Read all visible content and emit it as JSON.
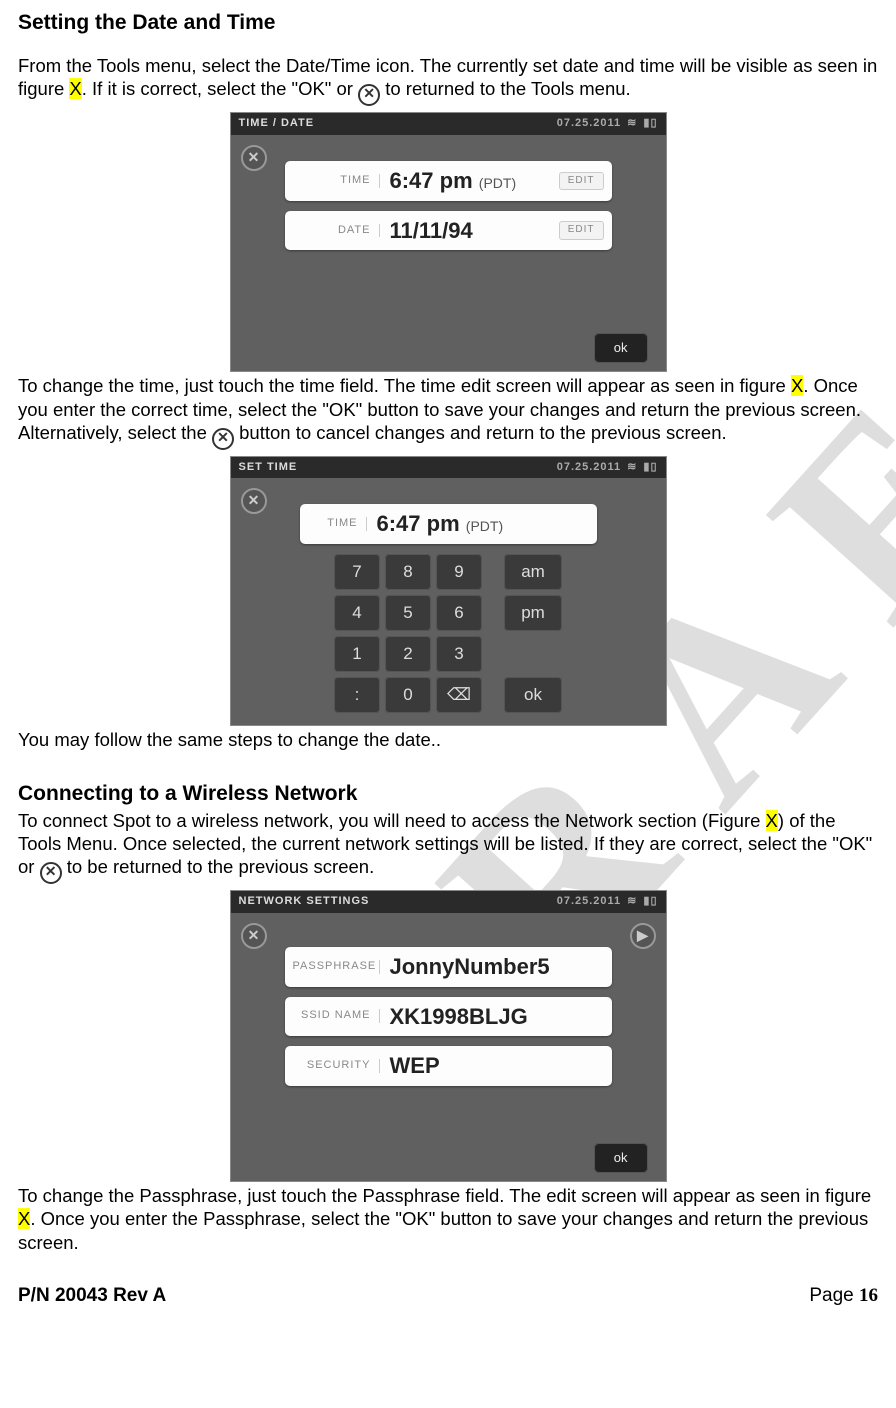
{
  "watermark": "DRAFT",
  "heading1": "Setting the Date and Time",
  "para1a": "From the Tools menu, select the Date/Time icon.  The currently set date and time will be visible as seen in figure ",
  "fig1": "X",
  "para1b": ".  If it is correct, select the \"OK\" or ",
  "para1c": " to returned to the Tools menu.",
  "screen1": {
    "title": "TIME / DATE",
    "date_status": "07.25.2011",
    "time_label": "TIME",
    "time_value": "6:47 pm",
    "tz": "(PDT)",
    "edit": "EDIT",
    "date_label": "DATE",
    "date_value": "11/11/94",
    "ok": "ok"
  },
  "para2a": "To change the time, just touch the time field.  The time edit screen will appear as seen in figure ",
  "fig2": "X",
  "para2b": ". Once you enter the correct time, select the \"OK\" button to save your changes and return the previous screen.  Alternatively, select the ",
  "para2c": " button to cancel changes and return to the previous screen.",
  "screen2": {
    "title": "SET  TIME",
    "date_status": "07.25.2011",
    "time_label": "TIME",
    "time_value": "6:47 pm",
    "tz": "(PDT)",
    "keys": [
      "7",
      "8",
      "9",
      "4",
      "5",
      "6",
      "1",
      "2",
      "3",
      ":",
      "0",
      "⌫"
    ],
    "ampm": [
      "am",
      "pm"
    ],
    "ok": "ok"
  },
  "para3": "You may follow the same steps to change the date..",
  "heading2": "Connecting to a Wireless Network",
  "para4a": "To connect Spot to a wireless network, you will need to access the Network section (Figure ",
  "fig3": "X",
  "para4b": ") of the Tools Menu.  Once selected, the current network settings will be listed.  If they are correct, select the \"OK\" or ",
  "para4c": " to be returned to the previous screen.",
  "screen3": {
    "title": "NETWORK  SETTINGS",
    "date_status": "07.25.2011",
    "pass_label": "PASSPHRASE",
    "pass_value": "JonnyNumber5",
    "ssid_label": "SSID NAME",
    "ssid_value": "XK1998BLJG",
    "sec_label": "SECURITY",
    "sec_value": "WEP",
    "ok": "ok"
  },
  "para5a": "To change the Passphrase, just touch the Passphrase field.  The edit screen will appear as seen in figure ",
  "fig4": "X",
  "para5b": ".  Once you enter the Passphrase, select the \"OK\" button to save your changes and return the previous screen.",
  "footer": {
    "pn": "P/N 20043 Rev A",
    "page_label": "Page ",
    "page_num": "16"
  }
}
